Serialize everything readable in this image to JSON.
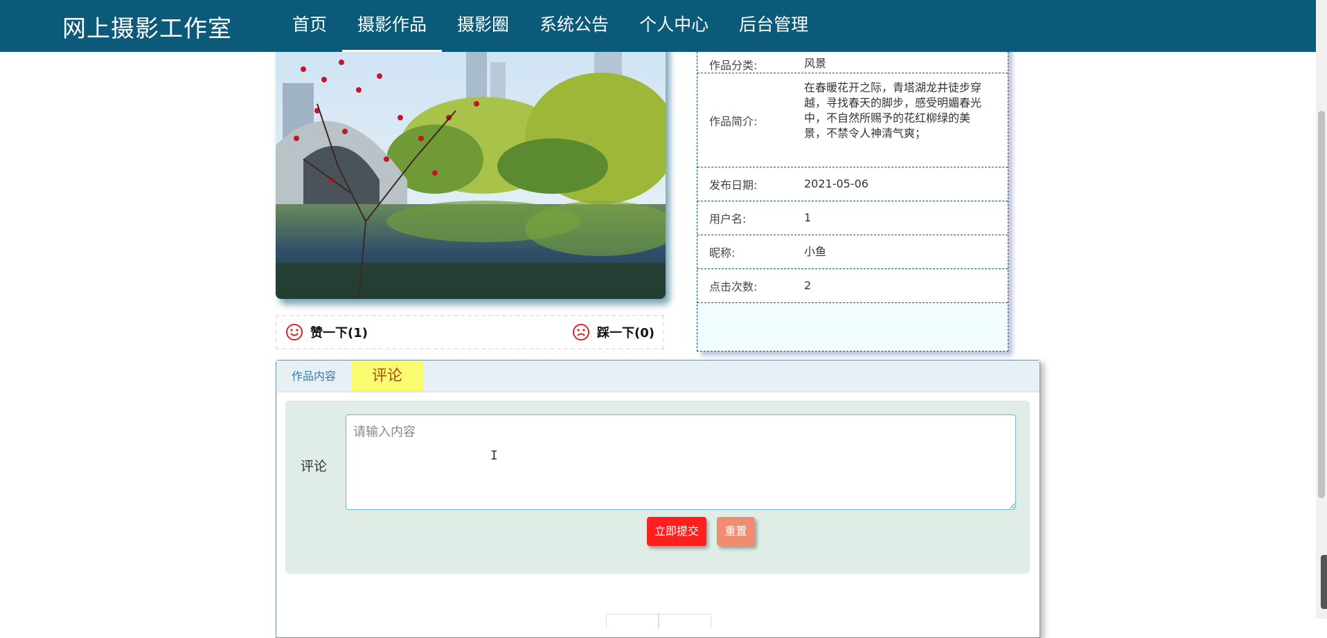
{
  "header": {
    "brand": "网上摄影工作室",
    "nav": [
      {
        "label": "首页"
      },
      {
        "label": "摄影作品"
      },
      {
        "label": "摄影圈"
      },
      {
        "label": "系统公告"
      },
      {
        "label": "个人中心"
      },
      {
        "label": "后台管理"
      }
    ],
    "active_nav": "摄影作品",
    "bg_color": "#0b5a7a"
  },
  "reactions": {
    "like_label": "赞一下(1)",
    "dislike_label": "踩一下(0)",
    "icon_color": "#e02020"
  },
  "info": {
    "rows": [
      {
        "label": "作品分类:",
        "value": "风景"
      },
      {
        "label": "作品简介:",
        "value": "在春暖花开之际，青塔湖龙井徒步穿越，寻找春天的脚步，感受明媚春光中，不自然所赐予的花红柳绿的美景，不禁令人神清气爽；"
      },
      {
        "label": "发布日期:",
        "value": "2021-05-06"
      },
      {
        "label": "用户名:",
        "value": "1"
      },
      {
        "label": "昵称:",
        "value": "小鱼"
      },
      {
        "label": "点击次数:",
        "value": "2"
      }
    ]
  },
  "tabs": [
    {
      "label": "作品内容"
    },
    {
      "label": "评论"
    }
  ],
  "comment_form": {
    "label": "评论",
    "placeholder": "请输入内容",
    "submit_label": "立即提交",
    "reset_label": "重置"
  }
}
